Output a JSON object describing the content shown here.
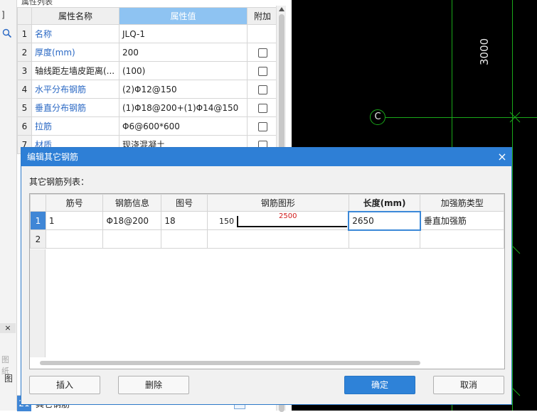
{
  "property_panel": {
    "title": "属性列表",
    "columns": [
      "属性名称",
      "属性值",
      "附加"
    ],
    "rows": [
      {
        "idx": "1",
        "name": "名称",
        "value": "JLQ-1",
        "checkbox": false
      },
      {
        "idx": "2",
        "name": "厚度(mm)",
        "value": "200",
        "checkbox": true
      },
      {
        "idx": "3",
        "name": "轴线距左墙皮距离(...",
        "value": "(100)",
        "checkbox": true
      },
      {
        "idx": "4",
        "name": "水平分布钢筋",
        "value": "(2)Φ12@150",
        "checkbox": true
      },
      {
        "idx": "5",
        "name": "垂直分布钢筋",
        "value": "(1)Φ18@200+(1)Φ14@150",
        "checkbox": true
      },
      {
        "idx": "6",
        "name": "拉筋",
        "value": "Φ6@600*600",
        "checkbox": true
      },
      {
        "idx": "7",
        "name": "材质",
        "value": "现浇混凝土",
        "checkbox": true
      }
    ],
    "bottom_row": {
      "idx": "21",
      "name": "其它钢筋"
    }
  },
  "left_strip": {
    "top_text": "]",
    "search_icon": "search-icon",
    "close_mark": "×",
    "text_a": "图",
    "text_b": "图纸"
  },
  "cad": {
    "dimension": "3000",
    "axis_label": "C"
  },
  "dialog": {
    "title": "编辑其它钢筋",
    "close": "×",
    "list_label": "其它钢筋列表：",
    "columns": [
      "筋号",
      "钢筋信息",
      "图号",
      "钢筋图形",
      "长度(mm)",
      "加强筋类型"
    ],
    "rows": [
      {
        "idx": "1",
        "bar_no": "1",
        "info": "Φ18@200",
        "shape_no": "18",
        "shape_left": "150",
        "shape_top": "2500",
        "length": "2650",
        "type": "垂直加强筋"
      },
      {
        "idx": "2",
        "bar_no": "",
        "info": "",
        "shape_no": "",
        "shape_left": "",
        "shape_top": "",
        "length": "",
        "type": ""
      }
    ],
    "buttons": {
      "insert": "插入",
      "delete": "删除",
      "ok": "确定",
      "cancel": "取消"
    }
  }
}
